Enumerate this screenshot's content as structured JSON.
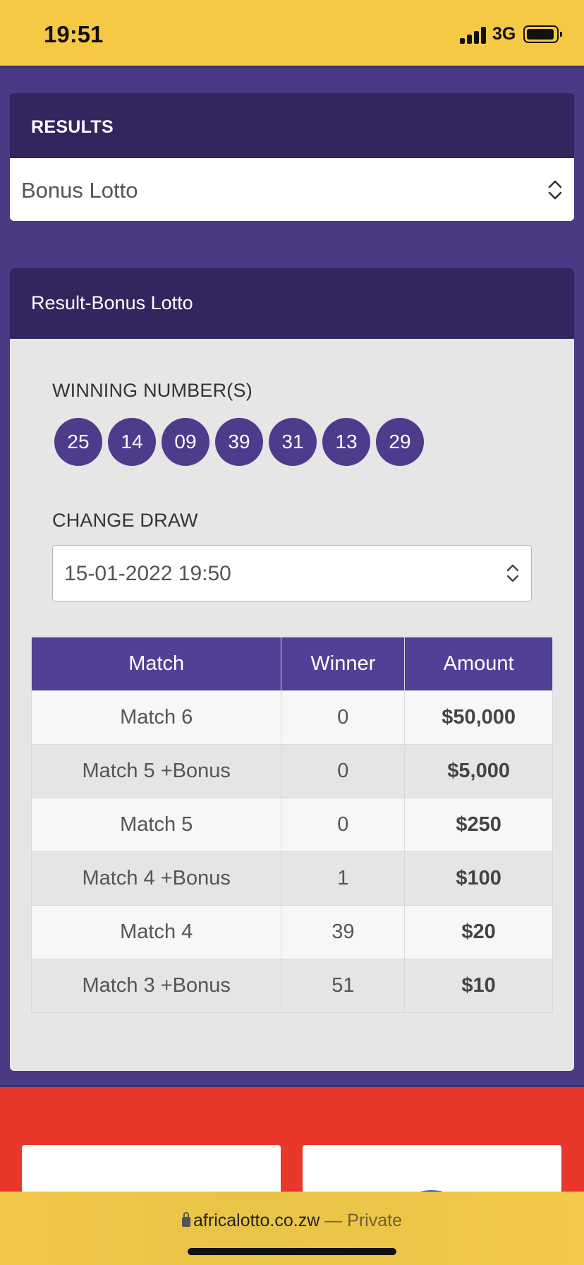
{
  "status_bar": {
    "time": "19:51",
    "network": "3G"
  },
  "results_panel": {
    "heading": "RESULTS",
    "game_select_value": "Bonus Lotto"
  },
  "result_panel": {
    "heading": "Result-Bonus Lotto",
    "winning_label": "WINNING NUMBER(S)",
    "winning_numbers": [
      "25",
      "14",
      "09",
      "39",
      "31",
      "13",
      "29"
    ],
    "change_draw_label": "CHANGE DRAW",
    "draw_select_value": "15-01-2022 19:50",
    "table": {
      "headers": [
        "Match",
        "Winner",
        "Amount"
      ],
      "rows": [
        [
          "Match 6",
          "0",
          "$50,000"
        ],
        [
          "Match 5 +Bonus",
          "0",
          "$5,000"
        ],
        [
          "Match 5",
          "0",
          "$250"
        ],
        [
          "Match 4 +Bonus",
          "1",
          "$100"
        ],
        [
          "Match 4",
          "39",
          "$20"
        ],
        [
          "Match 3 +Bonus",
          "51",
          "$10"
        ]
      ]
    }
  },
  "browser": {
    "url": "africalotto.co.zw",
    "separator": "—",
    "mode": "Private"
  },
  "colors": {
    "status_bar": "#f6c945",
    "page_bg": "#4a3a85",
    "header_bg": "#33255d",
    "ball": "#4e3b8c",
    "table_header": "#523f96",
    "promo_bg": "#e9372b"
  }
}
